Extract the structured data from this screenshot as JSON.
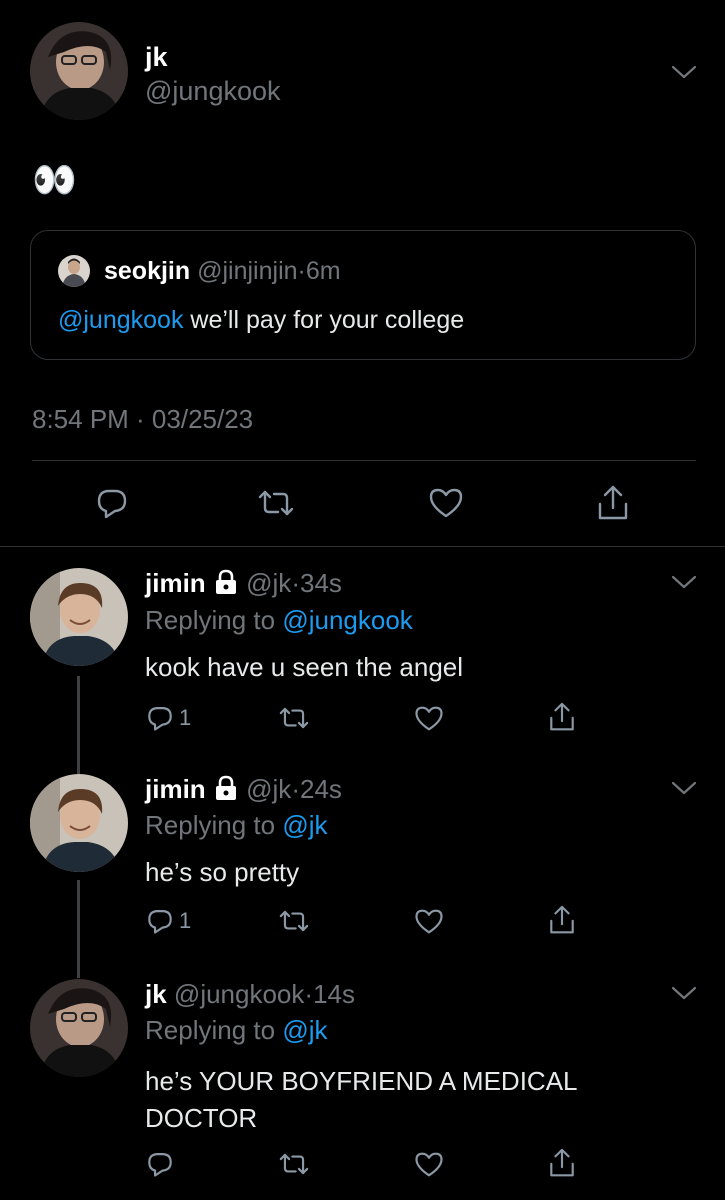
{
  "main_tweet": {
    "display_name": "jk",
    "handle": "@jungkook",
    "text": "👀",
    "timestamp": "8:54 PM · 03/25/23",
    "quoted": {
      "display_name": "seokjin",
      "handle": "@jinjinjin",
      "time": "6m",
      "mention": "@jungkook",
      "text": " we’ll pay for your college"
    }
  },
  "replies": [
    {
      "display_name": "jimin",
      "locked": true,
      "handle": "@jk",
      "time": "34s",
      "replying_label": "Replying to ",
      "replying_to": "@jungkook",
      "text": "kook have u seen the angel",
      "reply_count": "1"
    },
    {
      "display_name": "jimin",
      "locked": true,
      "handle": "@jk",
      "time": "24s",
      "replying_label": "Replying to ",
      "replying_to": "@jk",
      "text": "he’s so pretty",
      "reply_count": "1"
    },
    {
      "display_name": "jk",
      "locked": false,
      "handle": "@jungkook",
      "time": "14s",
      "replying_label": "Replying to ",
      "replying_to": "@jk",
      "text_line1": "he’s YOUR BOYFRIEND A MEDICAL",
      "text_line2": "DOCTOR",
      "reply_count": ""
    }
  ],
  "separator": "·",
  "colors": {
    "background": "#000000",
    "link": "#1d9bf0",
    "muted": "#71767b",
    "text": "#e7e9ea"
  }
}
